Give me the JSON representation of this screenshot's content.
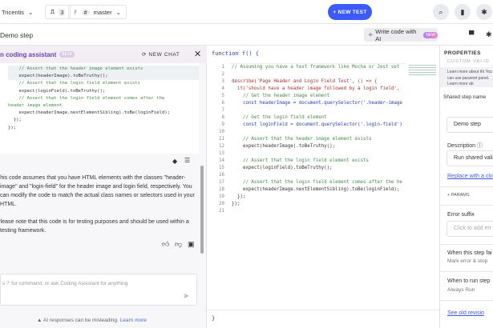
{
  "topbar": {
    "org": "Tricentis",
    "pr_count": "3",
    "branch": "master",
    "new_test": "+ NEW TEST"
  },
  "subbar": {
    "title": "Demo step",
    "write_ai": "Write code with AI",
    "new_badge": "NEW"
  },
  "chat": {
    "title": "n coding assistant",
    "beta": "BETA",
    "new_chat": "NEW CHAT",
    "code": [
      {
        "t": "    // Assert that the header image element exists",
        "c": true
      },
      {
        "t": "    expect(headerImage).toBeTruthy();",
        "c": false
      },
      {
        "t": "",
        "c": false
      },
      {
        "t": "    // Assert that the login field element exists",
        "c": true
      },
      {
        "t": "    expect(loginField).toBeTruthy();",
        "c": false
      },
      {
        "t": "",
        "c": false
      },
      {
        "t": "    // Assert that the login field element comes after the",
        "c": true
      },
      {
        "t": "header image element",
        "c": true
      },
      {
        "t": "    expect(headerImage.nextElementSibling).toBe(loginField);",
        "c": false
      },
      {
        "t": "  });",
        "c": false
      },
      {
        "t": "});",
        "c": false
      }
    ],
    "message_1": "This code assumes that you have HTML elements with the classes \"header-image\" and \"login-field\" for the header image and login field, respectively. You can modify the code to match the actual class names or selectors used in your HTML.",
    "message_2": "Please note that this code is for testing purposes and should be used within a testing framework.",
    "input_placeholder": "s '/' for command, or ask Coding Assistant for anything",
    "disclaimer": "AI responses can be misleading.",
    "learn_more": "Learn more"
  },
  "editor": {
    "header": "function f() {",
    "footer": "}",
    "lines": [
      "// Assuming you have a test framework like Mocha or Jest set",
      "",
      "describe('Page Header and Login Field Test', () => {",
      "  it('should have a header image followed by a login field',",
      "    // Get the header image element",
      "    const headerImage = document.querySelector('.header-image",
      "",
      "    // Get the login field element",
      "    const loginField = document.querySelector('.login-field')",
      "",
      "    // Assert that the header image element exists",
      "    expect(headerImage).toBeTruthy();",
      "",
      "    // Assert that the login field element exists",
      "    expect(loginField).toBeTruthy();",
      "",
      "    // Assert that the login field element comes after the he",
      "    expect(headerImage.nextElementSibling).toBe(loginField);",
      "  });",
      "});",
      ""
    ]
  },
  "props": {
    "title": "PROPERTIES",
    "subtitle": "CUSTOM VALID",
    "info": "Learn more about thi You can use paramet panel. Learn more ab",
    "name_label": "Shared step name",
    "name_value": "Demo step",
    "desc_label": "Description",
    "desc_value": "Run shared vali",
    "replace_link": "Replace with a clo",
    "params": "+ PARAMS",
    "error_label": "Error suffix",
    "error_placeholder": "Click to add err",
    "fail_label": "When this step fai",
    "fail_value": "Mark error & stop",
    "run_label": "When to run step",
    "run_value": "Always Run",
    "revision_link": "See old revisio"
  }
}
